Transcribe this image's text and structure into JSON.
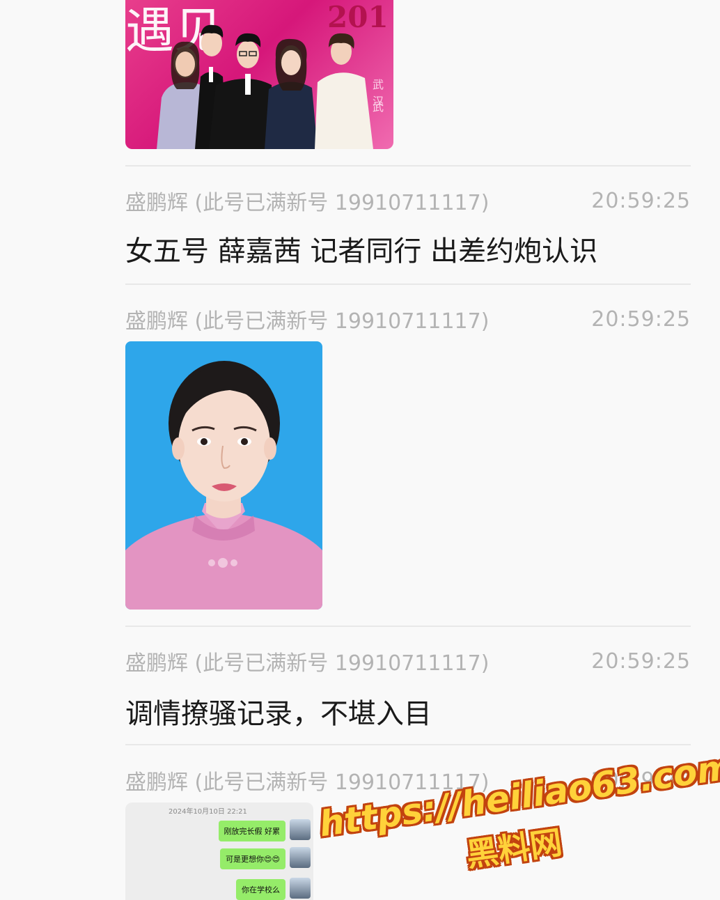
{
  "messages": [
    {
      "sender": "盛鹏辉 (此号已满新号 19910711117)",
      "time": "20:59:25",
      "text": "女五号 薛嘉茜 记者同行 出差约炮认识"
    },
    {
      "sender": "盛鹏辉 (此号已满新号 19910711117)",
      "time": "20:59:25",
      "image": "id-portrait-photo"
    },
    {
      "sender": "盛鹏辉 (此号已满新号 19910711117)",
      "time": "20:59:25",
      "text": "调情撩骚记录，不堪入目"
    },
    {
      "sender": "盛鹏辉 (此号已满新号 19910711117)",
      "time": "20:59:25",
      "image": "chat-screenshot"
    }
  ],
  "photo1": {
    "banner_text": "遇见",
    "banner_year": "201",
    "side_text_1": "武汉",
    "side_text_2": "武"
  },
  "chat_screenshot": {
    "timestamp": "2024年10月10日 22:21",
    "bubbles": [
      "刚放完长假 好累",
      "可是更想你😍😍",
      "你在学校么"
    ]
  },
  "watermark": {
    "url": "https://heiliao63.com",
    "name": "黑料网"
  },
  "colors": {
    "meta_text": "#b3b3b3",
    "body_text": "#1a1a1a",
    "portrait_bg": "#2ea6ea",
    "bubble_green": "#95ec69"
  }
}
